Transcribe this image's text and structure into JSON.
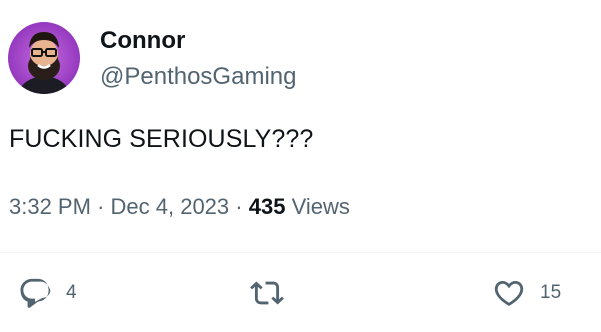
{
  "author": {
    "name": "Connor",
    "handle": "@PenthosGaming"
  },
  "tweet": {
    "text": "FUCKING SERIOUSLY???",
    "time": "3:32 PM",
    "separator": "·",
    "date": "Dec 4, 2023",
    "views_count": "435",
    "views_label": "Views"
  },
  "actions": {
    "reply_count": "4",
    "like_count": "15"
  },
  "icons": {
    "reply": "reply-icon",
    "retweet": "retweet-icon",
    "like": "heart-icon"
  },
  "colors": {
    "text_primary": "#0f1419",
    "text_secondary": "#536471",
    "avatar_background": "#9b3fc9"
  }
}
